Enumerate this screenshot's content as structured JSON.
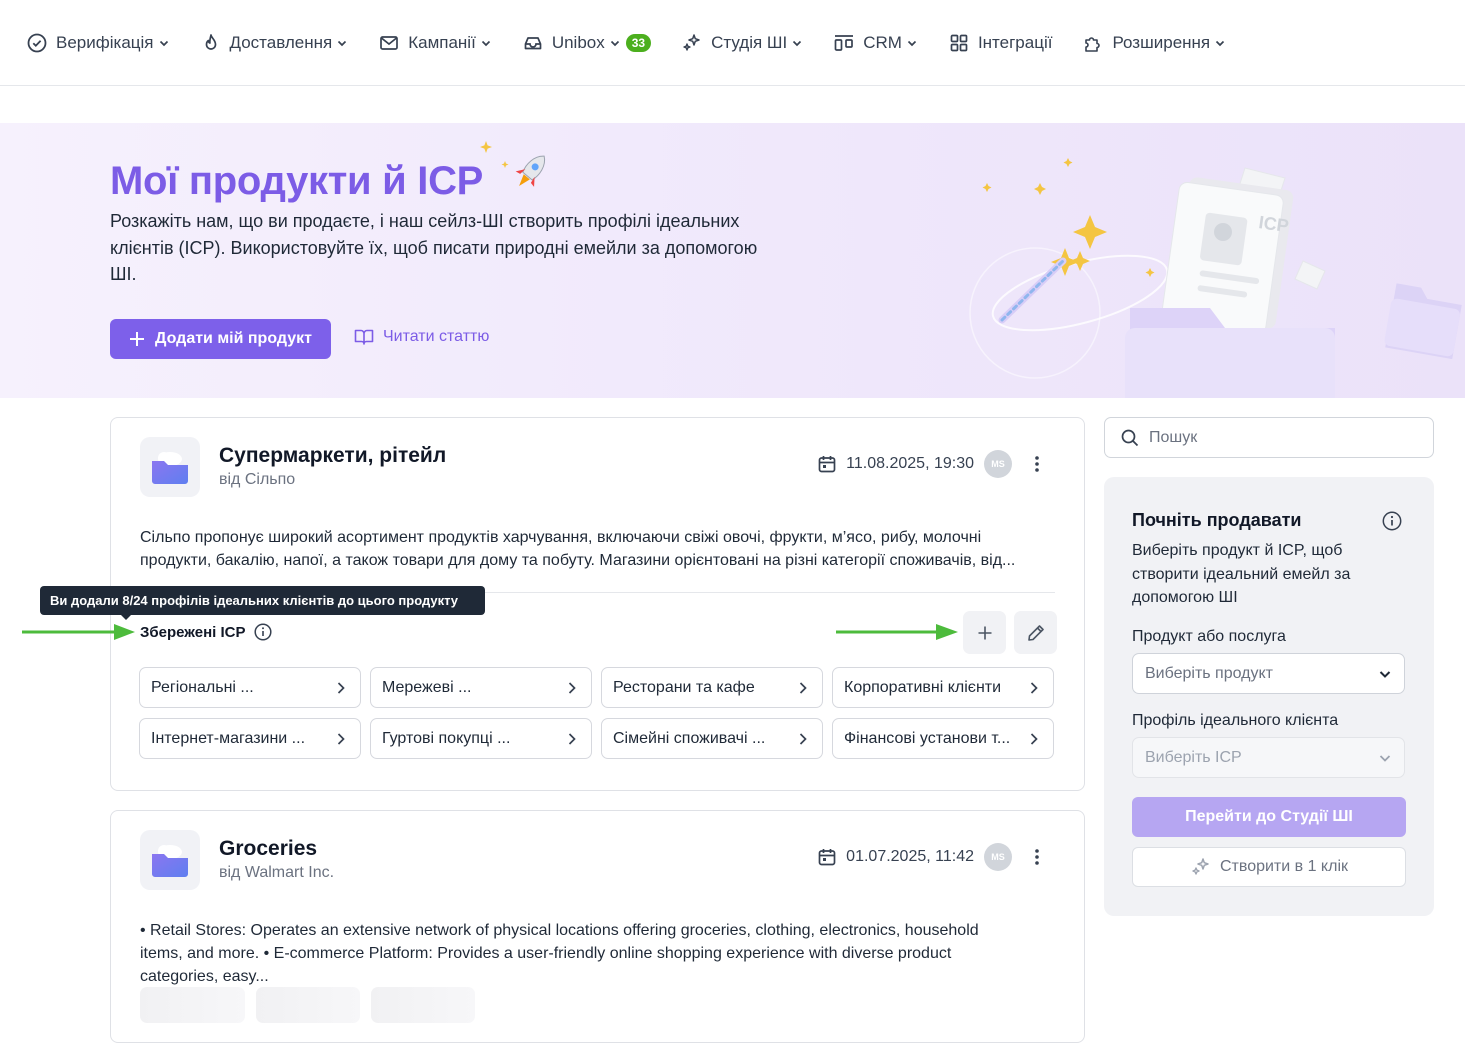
{
  "nav": [
    {
      "label": "Верифікація",
      "icon": "check-circle-icon",
      "dropdown": true
    },
    {
      "label": "Доставлення",
      "icon": "flame-icon",
      "dropdown": true
    },
    {
      "label": "Кампанії",
      "icon": "mail-icon",
      "dropdown": true
    },
    {
      "label": "Unibox",
      "icon": "inbox-icon",
      "dropdown": true,
      "badge": "33"
    },
    {
      "label": "Студія ШІ",
      "icon": "sparkles-icon",
      "dropdown": true
    },
    {
      "label": "CRM",
      "icon": "crm-icon",
      "dropdown": true
    },
    {
      "label": "Інтеграції",
      "icon": "grid-icon",
      "dropdown": false
    },
    {
      "label": "Розширення",
      "icon": "puzzle-icon",
      "dropdown": true
    }
  ],
  "hero": {
    "title": "Мої продукти й ICP",
    "description": "Розкажіть нам, що ви продаєте, і наш сейлз-ШІ створить профілі ідеальних клієнтів (ICP). Використовуйте їх, щоб писати природні емейли за допомогою ШІ.",
    "add_button": "Додати мій продукт",
    "read_link": "Читати статтю",
    "illustration_label": "ICP"
  },
  "products": [
    {
      "title": "Супермаркети, рітейл",
      "by": "від Сільпо",
      "date": "11.08.2025, 19:30",
      "avatar": "MS",
      "description": "Сільпо пропонує широкий асортимент продуктів харчування, включаючи свіжі овочі, фрукти, м’ясо, рибу, молочні продукти, бакалію, напої, а також товари для дому та побуту. Магазини орієнтовані на різні категорії споживачів, від...",
      "saved_label": "Збережені ICP",
      "icps": [
        "Регіональні ...",
        "Мережеві ...",
        "Ресторани та кафе",
        "Корпоративні клієнти",
        "Інтернет-магазини ...",
        "Гуртові покупці ...",
        "Сімейні споживачі ...",
        "Фінансові установи т..."
      ]
    },
    {
      "title": "Groceries",
      "by": "від Walmart Inc.",
      "date": "01.07.2025, 11:42",
      "avatar": "MS",
      "description": "• Retail Stores: Operates an extensive network of physical locations offering groceries, clothing, electronics, household items, and more. • E-commerce Platform: Provides a user-friendly online shopping experience with diverse product categories, easy..."
    }
  ],
  "tooltip": "Ви додали 8/24 профілів ідеальних клієнтів до цього продукту",
  "search": {
    "placeholder": "Пошук"
  },
  "sidebar": {
    "title": "Почніть продавати",
    "description": "Виберіть продукт й ICP, щоб створити ідеальний емейл за допомогою ШІ",
    "product_label": "Продукт або послуга",
    "product_placeholder": "Виберіть продукт",
    "icp_label": "Профіль ідеального клієнта",
    "icp_placeholder": "Виберіть ICP",
    "go_button": "Перейти до Студії ШІ",
    "oneclick_button": "Створити в 1 клік"
  },
  "colors": {
    "accent": "#7d60ea",
    "annotation_arrow": "#4dbb3c",
    "badge": "#4caf1e"
  }
}
